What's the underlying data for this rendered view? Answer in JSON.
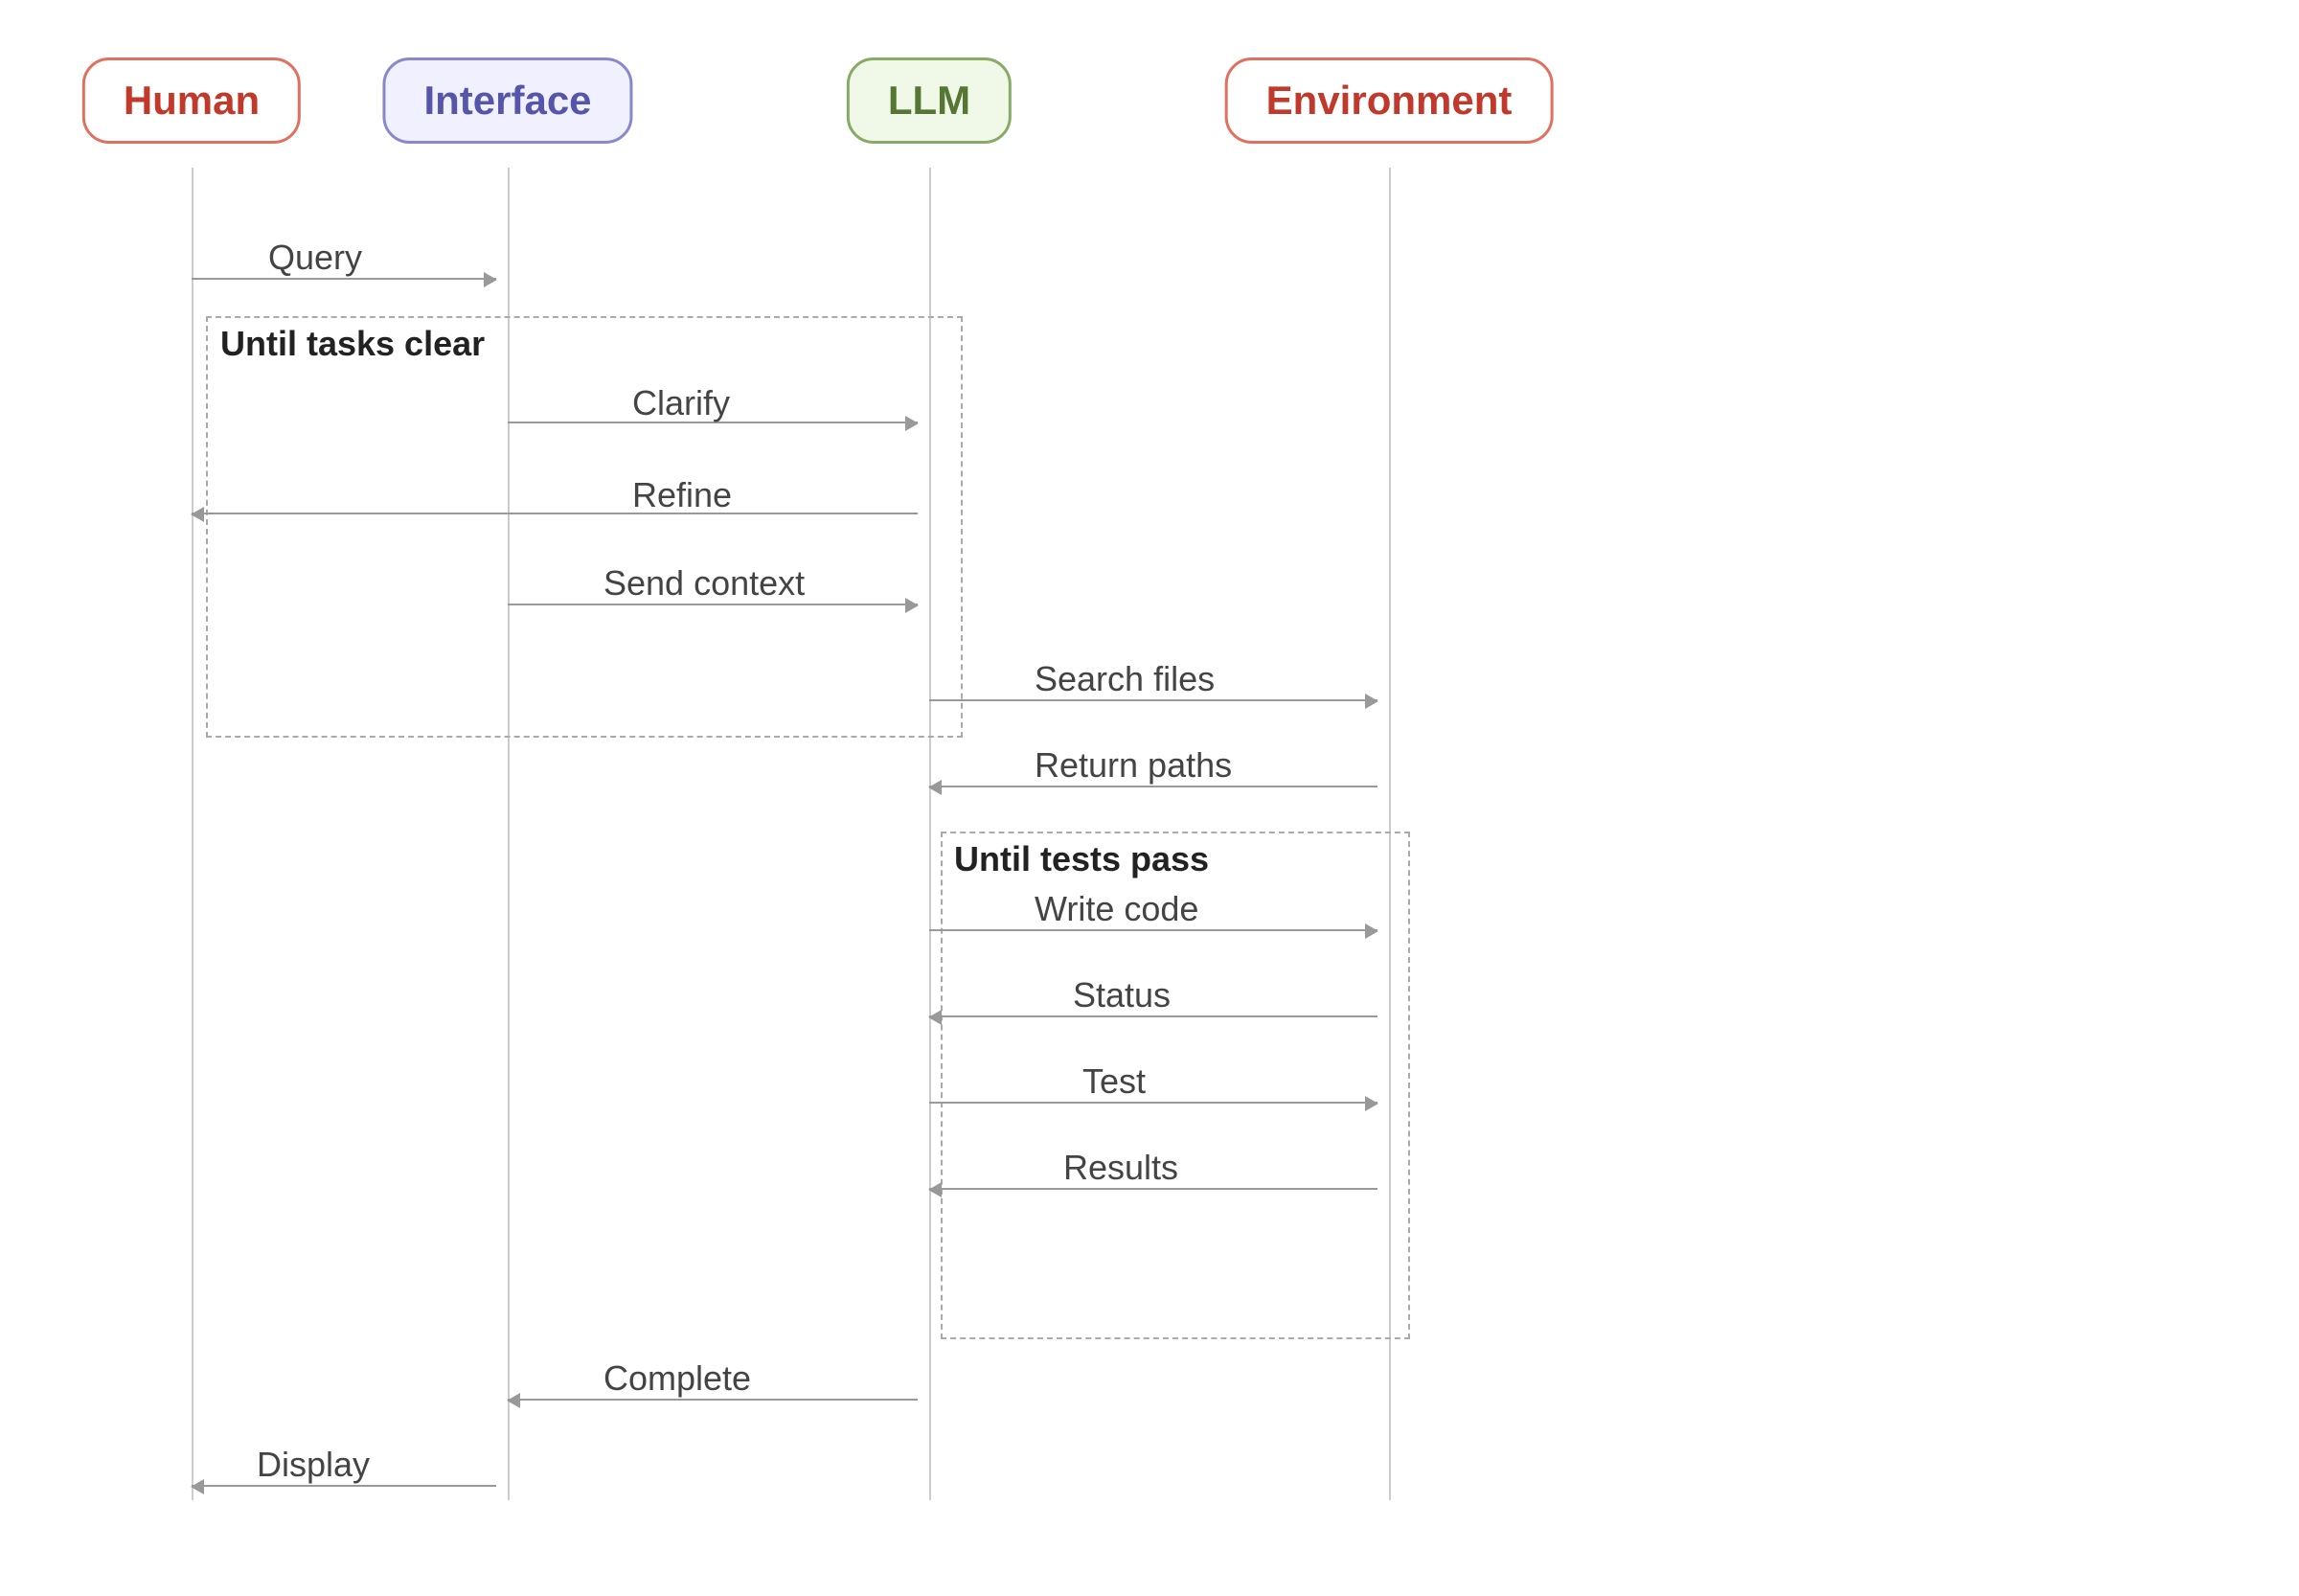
{
  "actors": {
    "human": {
      "label": "Human"
    },
    "interface": {
      "label": "Interface"
    },
    "llm": {
      "label": "LLM"
    },
    "environment": {
      "label": "Environment"
    }
  },
  "loops": {
    "tasks_clear": "Until tasks clear",
    "tests_pass": "Until tests pass"
  },
  "arrows": [
    {
      "label": "Query",
      "direction": "right"
    },
    {
      "label": "Clarify",
      "direction": "right"
    },
    {
      "label": "Refine",
      "direction": "left"
    },
    {
      "label": "Send context",
      "direction": "right"
    },
    {
      "label": "Search files",
      "direction": "right"
    },
    {
      "label": "Return paths",
      "direction": "left"
    },
    {
      "label": "Write code",
      "direction": "right"
    },
    {
      "label": "Status",
      "direction": "left"
    },
    {
      "label": "Test",
      "direction": "right"
    },
    {
      "label": "Results",
      "direction": "left"
    },
    {
      "label": "Complete",
      "direction": "left"
    },
    {
      "label": "Display",
      "direction": "left"
    }
  ]
}
